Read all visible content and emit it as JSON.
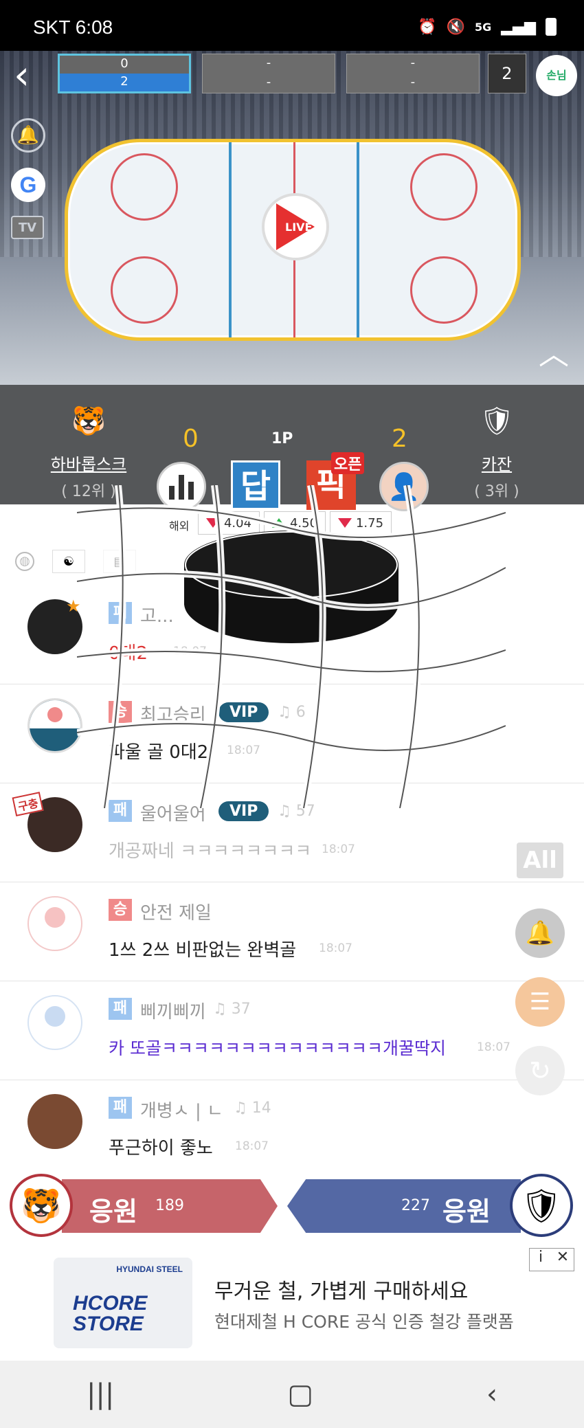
{
  "status_bar": {
    "carrier_time": "SKT 6:08",
    "net": "5G"
  },
  "scoreboard": {
    "period1": {
      "top": "0",
      "bottom": "2"
    },
    "period2": {
      "top": "-",
      "bottom": "-"
    },
    "period3": {
      "top": "-",
      "bottom": "-"
    },
    "total": "2",
    "guest_label": "손님"
  },
  "side_icons": {
    "google": "G",
    "tv": "TV"
  },
  "live_label": "LIVE",
  "match": {
    "home": {
      "name": "하바롭스크",
      "rank": "( 12위 )",
      "score": "0"
    },
    "away": {
      "name": "카잔",
      "rank": "( 3위 )",
      "score": "2"
    },
    "period": "1P",
    "dap_label": "답",
    "pick_label": "픽",
    "open_label": "오픈"
  },
  "odds": {
    "label": "해외",
    "values": [
      "4.04",
      "4.50",
      "1.75"
    ]
  },
  "messages": [
    {
      "badge": "패",
      "nick": "고...",
      "vip": "",
      "likes": "",
      "text": "0대2",
      "time": "18:07"
    },
    {
      "badge": "승",
      "nick": "최고승리",
      "vip": "VIP",
      "likes": "6",
      "text": "파울 골 0대2",
      "time": "18:07"
    },
    {
      "badge": "패",
      "nick": "울어울어",
      "vip": "VIP",
      "likes": "57",
      "text": "개공짜네 ㅋㅋㅋㅋㅋㅋㅋㅋ",
      "time": "18:07"
    },
    {
      "badge": "승",
      "nick": "안전 제일",
      "vip": "",
      "likes": "",
      "text": "1쓰 2쓰 비판없는 완벽골",
      "time": "18:07"
    },
    {
      "badge": "패",
      "nick": "삐끼삐끼",
      "vip": "",
      "likes": "37",
      "text": "카 또골ㅋㅋㅋㅋㅋㅋㅋㅋㅋㅋㅋㅋㅋㅋ개꿀딱지",
      "time": "18:07"
    },
    {
      "badge": "패",
      "nick": "개병ㅅ | ㄴ",
      "vip": "",
      "likes": "14",
      "text": "푸근하이 좋노",
      "time": "18:07"
    }
  ],
  "avatar_tag": "구충",
  "fab": {
    "all_label": "All"
  },
  "cheer": {
    "home_label": "응원",
    "home_count": "189",
    "away_label": "응원",
    "away_count": "227"
  },
  "ad": {
    "title": "무거운 철, 가볍게 구매하세요",
    "subtitle": "현대제철 H CORE 공식 인증 철강 플랫폼",
    "logo_line1": "HCORE",
    "logo_line2": "STORE",
    "brand": "HYUNDAI STEEL",
    "info": "i",
    "close": "✕"
  },
  "colors": {
    "accent_blue": "#2f7fd5",
    "home_red": "#c6646a",
    "away_blue": "#5468a4",
    "score_yellow": "#f5c128"
  }
}
